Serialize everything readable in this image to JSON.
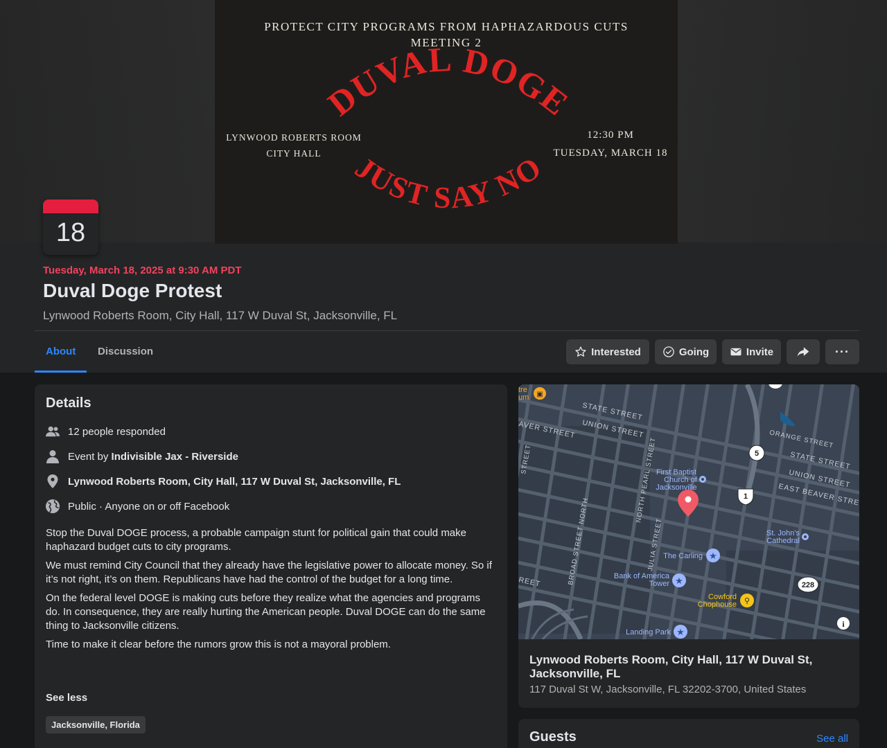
{
  "cover": {
    "line1": "PROTECT CITY PROGRAMS FROM HAPHAZARDOUS CUTS",
    "line2": "MEETING 2",
    "arc_top": "DUVAL DOGE",
    "arc_bottom": "JUST SAY NO",
    "left1": "LYNWOOD ROBERTS ROOM",
    "left2": "CITY HALL",
    "right1": "12:30 PM",
    "right2": "TUESDAY, MARCH 18"
  },
  "calendar": {
    "day": "18"
  },
  "event": {
    "datetime": "Tuesday, March 18, 2025 at 9:30 AM PDT",
    "title": "Duval Doge Protest",
    "location": "Lynwood Roberts Room, City Hall, 117 W Duval St, Jacksonville, FL"
  },
  "tabs": [
    {
      "label": "About",
      "active": true
    },
    {
      "label": "Discussion",
      "active": false
    }
  ],
  "actions": {
    "interested": "Interested",
    "going": "Going",
    "invite": "Invite",
    "share_icon": "share-icon",
    "more": "···"
  },
  "details": {
    "heading": "Details",
    "responded": "12 people responded",
    "event_by_prefix": "Event by",
    "event_by_name": "Indivisible Jax - Riverside",
    "address": "Lynwood Roberts Room, City Hall, 117 W Duval St, Jacksonville, FL",
    "privacy": "Public · Anyone on or off Facebook",
    "description": [
      "Stop the Duval DOGE process, a probable campaign stunt for political gain that could make haphazard budget cuts to city programs.",
      "We must remind City Council that they already have the legislative power to allocate money. So if it’s not right, it’s on them. Republicans have had the control of the budget for a long time.",
      "On the federal level DOGE is making cuts before they realize what the agencies and programs do. In consequence, they are really hurting the American people. Duval DOGE can do the same thing to Jacksonville citizens.",
      "Time to make it clear before the rumors grow this is not a mayoral problem."
    ],
    "see_less": "See less",
    "tag": "Jacksonville, Florida"
  },
  "map": {
    "streets": {
      "state": "STATE STREET",
      "union": "UNION STREET",
      "beaver": "AVER STREET",
      "orange": "ORANGE STREET",
      "state_r": "STATE STREET",
      "union_r": "UNION STREET",
      "east_beaver": "EAST BEAVER STREE",
      "north_pearl": "NORTH PEARL STREET",
      "julia": "JULIA STREET",
      "broad": "BROAD STREET NORTH",
      "reet_left": "REET",
      "reet_top": "STREET"
    },
    "pois": {
      "museum": "tre\num",
      "first_baptist": "First Baptist\nChurch of\nJacksonville",
      "st_johns": "St. John's\nCathedral",
      "carling": "The Carling",
      "boa": "Bank of America\nTower",
      "cowford": "Cowford\nChophouse",
      "landing": "Landing Park"
    },
    "shields": [
      "5",
      "1",
      "228"
    ],
    "info": "i",
    "title": "Lynwood Roberts Room, City Hall, 117 W Duval St, Jacksonville, FL",
    "address": "117 Duval St W, Jacksonville, FL 32202-3700, United States"
  },
  "guests": {
    "heading": "Guests",
    "see_all": "See all"
  },
  "colors": {
    "accent": "#2d88ff",
    "date_red": "#f3425f",
    "cover_red": "#e02424",
    "calendar_red": "#e41e3f"
  }
}
